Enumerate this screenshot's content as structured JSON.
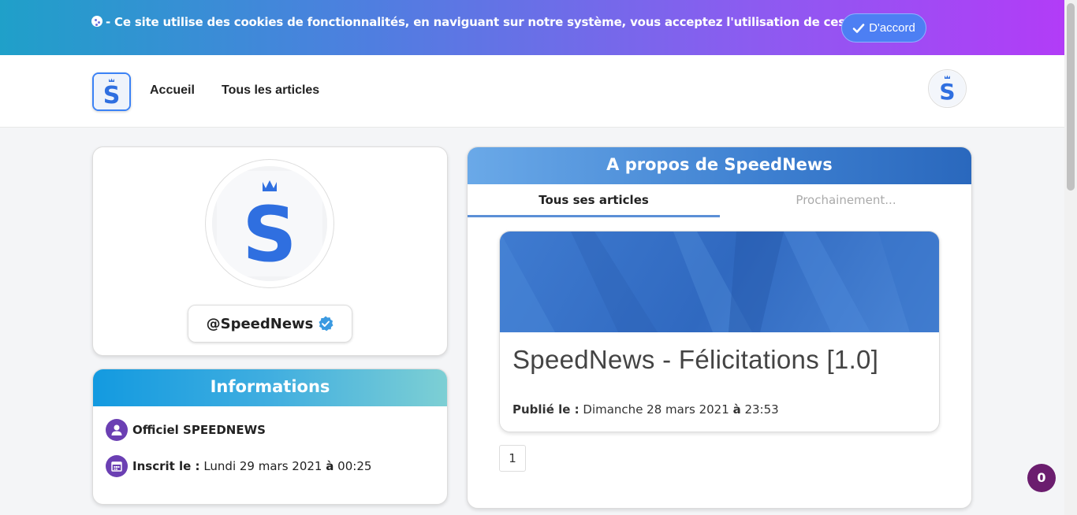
{
  "cookie_banner": {
    "icon": "cookie-icon",
    "text": "- Ce site utilise des cookies de fonctionnalités, en naviguant sur notre système, vous acceptez l'utilisation de ces derniers.",
    "button_label": "D'accord"
  },
  "navbar": {
    "links": [
      "Accueil",
      "Tous les articles"
    ]
  },
  "profile": {
    "handle": "@SpeedNews"
  },
  "informations": {
    "title": "Informations",
    "name": "Officiel SPEEDNEWS",
    "registered_label": "Inscrit le :",
    "registered_date": "Lundi 29 mars 2021",
    "registered_at": "à",
    "registered_time": "00:25"
  },
  "about": {
    "title": "A propos de SpeedNews",
    "tabs": [
      "Tous ses articles",
      "Prochainement..."
    ],
    "articles": [
      {
        "title": "SpeedNews - Félicitations [1.0]",
        "published_label": "Publié le :",
        "date": "Dimanche 28 mars 2021",
        "at": "à",
        "time": "23:53"
      }
    ],
    "pagination": [
      "1"
    ]
  },
  "notification_count": "0",
  "colors": {
    "brand_blue": "#2f6fe0",
    "badge_purple": "#6b1d6e",
    "icon_purple": "#6b3fb3"
  }
}
